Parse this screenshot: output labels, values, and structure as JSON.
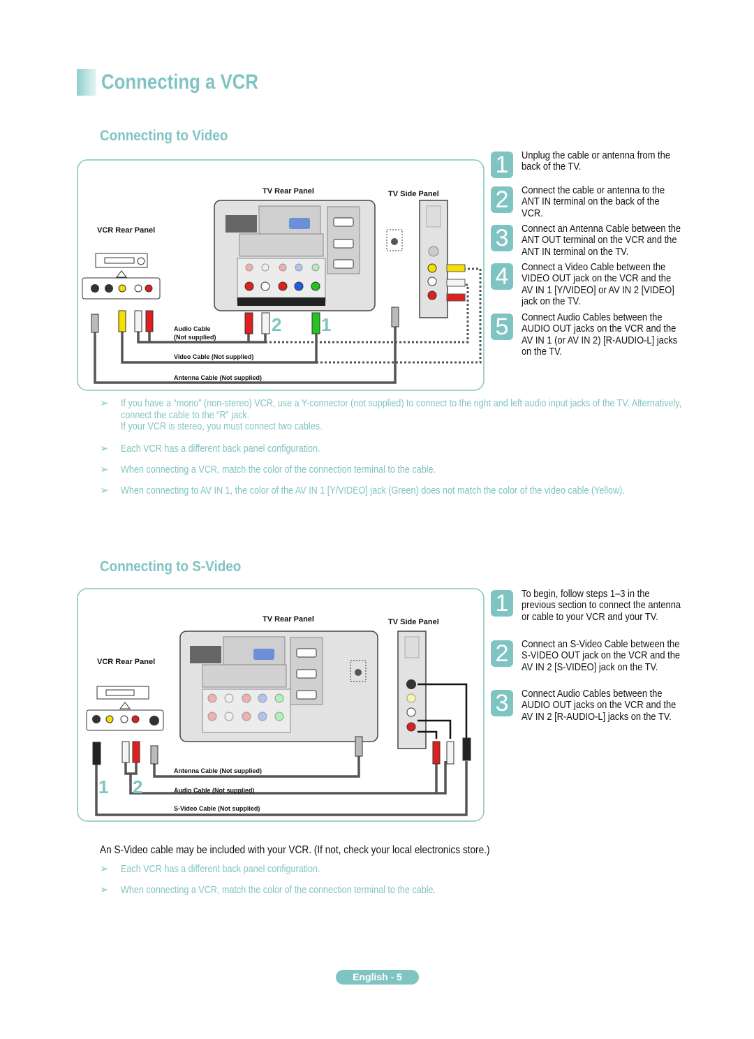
{
  "page": {
    "title": "Connecting a VCR",
    "footer": "English - 5"
  },
  "video": {
    "heading": "Connecting to Video",
    "diagram": {
      "tv_rear": "TV Rear Panel",
      "tv_side": "TV Side Panel",
      "vcr_rear": "VCR Rear Panel",
      "audio_cable": "Audio Cable",
      "audio_cable_note": "(Not supplied)",
      "video_cable": "Video Cable (Not supplied)",
      "antenna_cable": "Antenna Cable (Not supplied)",
      "markers": [
        "2",
        "1"
      ]
    },
    "steps": [
      {
        "num": "1",
        "text": "Unplug the cable or antenna from the back of the TV."
      },
      {
        "num": "2",
        "text": "Connect the cable or antenna to the ANT IN terminal on the back of the VCR."
      },
      {
        "num": "3",
        "text": "Connect an Antenna Cable between the ANT OUT terminal on the VCR and the ANT IN terminal on the TV."
      },
      {
        "num": "4",
        "text": "Connect a Video Cable between the VIDEO OUT jack on the VCR and the AV IN 1 [Y/VIDEO] or AV IN 2 [VIDEO] jack on the TV."
      },
      {
        "num": "5",
        "text": "Connect Audio Cables between the AUDIO OUT jacks on the VCR and the AV IN 1 (or AV IN 2) [R-AUDIO-L] jacks on the TV."
      }
    ],
    "notes": [
      {
        "line1": "If you have a “mono” (non-stereo) VCR, use a Y-connector (not supplied) to connect to the right and left audio input jacks of the TV. Alternatively, connect the cable to the “R” jack.",
        "line2": "If your VCR is stereo, you must connect two cables."
      },
      {
        "line1": "Each VCR has a different back panel configuration."
      },
      {
        "line1": "When connecting a VCR, match the color of the connection terminal to the cable."
      },
      {
        "line1": "When connecting to AV IN 1, the color of the AV IN 1 [Y/VIDEO] jack (Green) does not match the color of the video cable (Yellow)."
      }
    ]
  },
  "svideo": {
    "heading": "Connecting to S-Video",
    "diagram": {
      "tv_rear": "TV Rear Panel",
      "tv_side": "TV Side Panel",
      "vcr_rear": "VCR Rear Panel",
      "antenna_cable": "Antenna Cable (Not supplied)",
      "audio_cable": "Audio Cable (Not supplied)",
      "svideo_cable": "S-Video Cable (Not supplied)",
      "markers": [
        "1",
        "2"
      ]
    },
    "steps": [
      {
        "num": "1",
        "text": "To begin, follow steps 1–3 in the previous section to connect the antenna or cable to your VCR and your TV."
      },
      {
        "num": "2",
        "text": "Connect an S-Video Cable between the S-VIDEO OUT jack on the VCR and the AV IN 2 [S-VIDEO] jack on the TV."
      },
      {
        "num": "3",
        "text": "Connect Audio Cables between the AUDIO OUT jacks on the VCR and the AV IN 2 [R-AUDIO-L] jacks on the TV."
      }
    ],
    "info": "An S-Video cable may be included with your VCR. (If not, check your local electronics store.)",
    "notes": [
      {
        "line1": "Each VCR has a different back panel configuration."
      },
      {
        "line1": "When connecting a VCR, match the color of the connection terminal to the cable."
      }
    ]
  },
  "icons": {
    "note_arrow": "➢"
  },
  "colors": {
    "accent": "#7fc4c2",
    "red": "#e0201e",
    "white": "#f4f4f4",
    "yellow": "#f5e000",
    "green": "#22c422"
  }
}
